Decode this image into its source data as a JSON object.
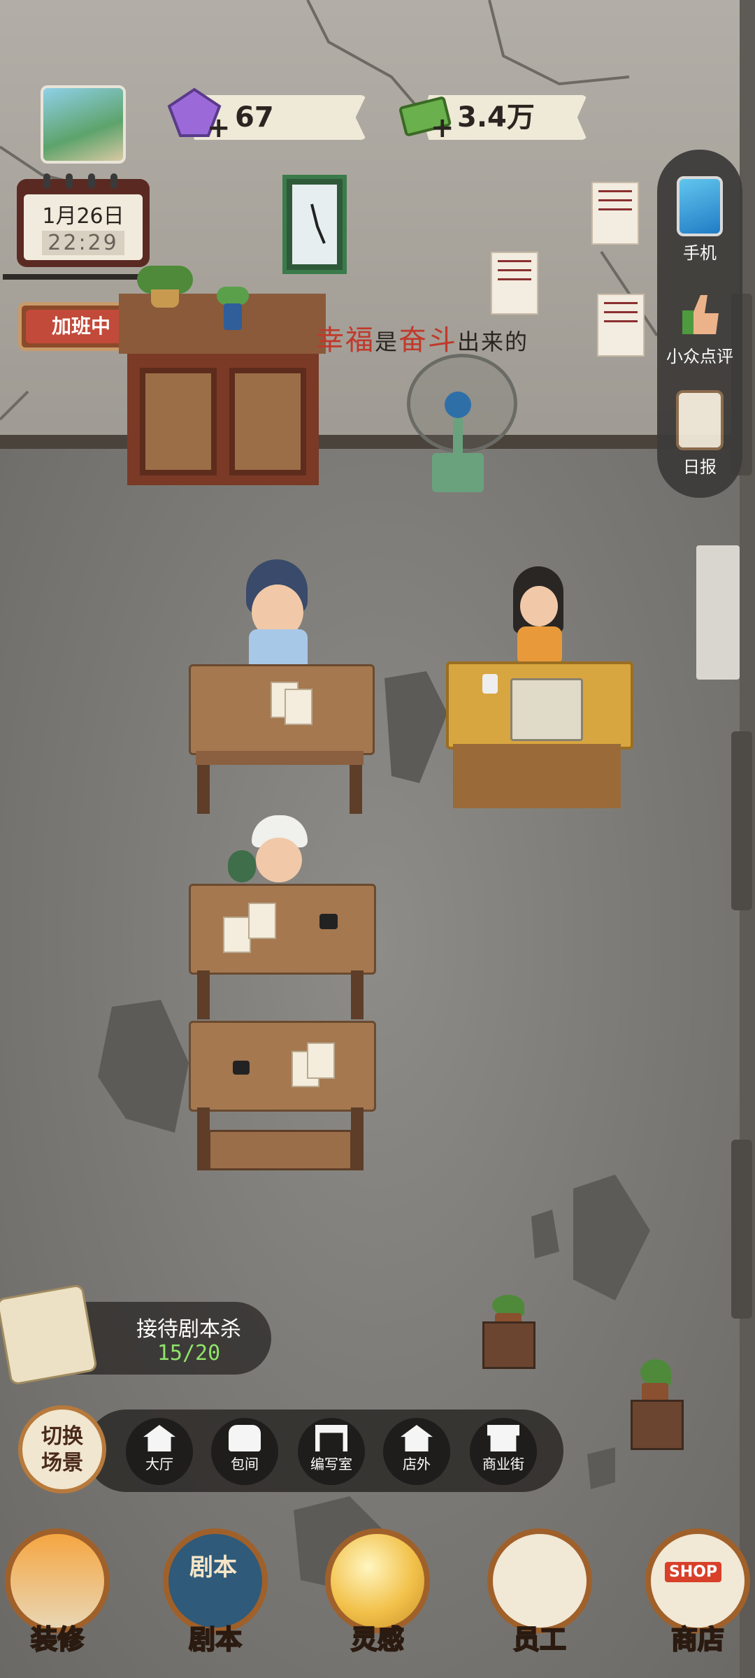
{
  "resources": {
    "gems": "67",
    "cash": "3.4万",
    "add_symbol": "+"
  },
  "calendar": {
    "date": "1月26日",
    "time": "22:29"
  },
  "status_sign": "加班中",
  "wall_slogan": {
    "red1": "幸福",
    "black1": "是",
    "red2": "奋斗",
    "black2": "出来的"
  },
  "sidebar": [
    {
      "label": "手机",
      "icon": "phone-icon"
    },
    {
      "label": "小众点评",
      "icon": "thumbs-up-icon"
    },
    {
      "label": "日报",
      "icon": "clipboard-icon"
    }
  ],
  "quest": {
    "title": "接待剧本杀",
    "progress": "15/20"
  },
  "scene_switch_label": "切换场景",
  "scenes": [
    {
      "label": "大厅",
      "icon": "house-icon"
    },
    {
      "label": "包间",
      "icon": "sofa-icon"
    },
    {
      "label": "编写室",
      "icon": "desk-icon"
    },
    {
      "label": "店外",
      "icon": "storefront-icon"
    },
    {
      "label": "商业街",
      "icon": "shop-awning-icon"
    }
  ],
  "bottom_nav": [
    {
      "label": "装修",
      "icon": "house-decor-icon"
    },
    {
      "label": "剧本",
      "icon": "script-book-icon"
    },
    {
      "label": "灵感",
      "icon": "lightbulb-icon"
    },
    {
      "label": "员工",
      "icon": "staff-badge-icon"
    },
    {
      "label": "商店",
      "icon": "shop-icon"
    }
  ],
  "decor_text": {
    "book_cover": "剧本",
    "shop_sign": "SHOP"
  },
  "colors": {
    "accent_red": "#c24a3a",
    "progress_green": "#8fe36a",
    "wood": "#a57850"
  }
}
